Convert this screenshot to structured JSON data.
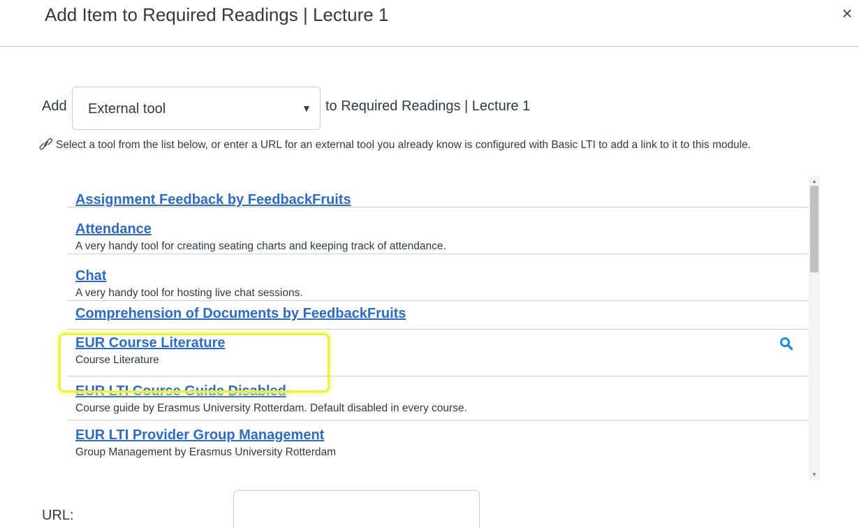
{
  "dialog": {
    "title": "Add Item to Required Readings | Lecture 1",
    "close_label": "×"
  },
  "add_row": {
    "add_label": "Add",
    "selected_type": "External tool",
    "select_arrow": "▼",
    "to_label": "to Required Readings | Lecture 1"
  },
  "instructions": "Select a tool from the list below, or enter a URL for an external tool you already know is configured with Basic LTI to add a link to it to this module.",
  "tools": [
    {
      "name": "Assignment Feedback by FeedbackFruits",
      "description": ""
    },
    {
      "name": "Attendance",
      "description": "A very handy tool for creating seating charts and keeping track of attendance."
    },
    {
      "name": "Chat",
      "description": "A very handy tool for hosting live chat sessions."
    },
    {
      "name": "Comprehension of Documents by FeedbackFruits",
      "description": ""
    },
    {
      "name": "EUR Course Literature",
      "description": "Course Literature"
    },
    {
      "name": "EUR LTI Course Guide Disabled",
      "description": "Course guide by Erasmus University Rotterdam. Default disabled in every course."
    },
    {
      "name": "EUR LTI Provider Group Management",
      "description": "Group Management by Erasmus University Rotterdam"
    }
  ],
  "scrollbar": {
    "up_arrow": "▲",
    "down_arrow": "▼"
  },
  "url_field": {
    "label": "URL:",
    "value": ""
  },
  "colors": {
    "link": "#2d6cc6",
    "highlight": "#e8f23c",
    "search_icon": "#1a8fd8"
  }
}
